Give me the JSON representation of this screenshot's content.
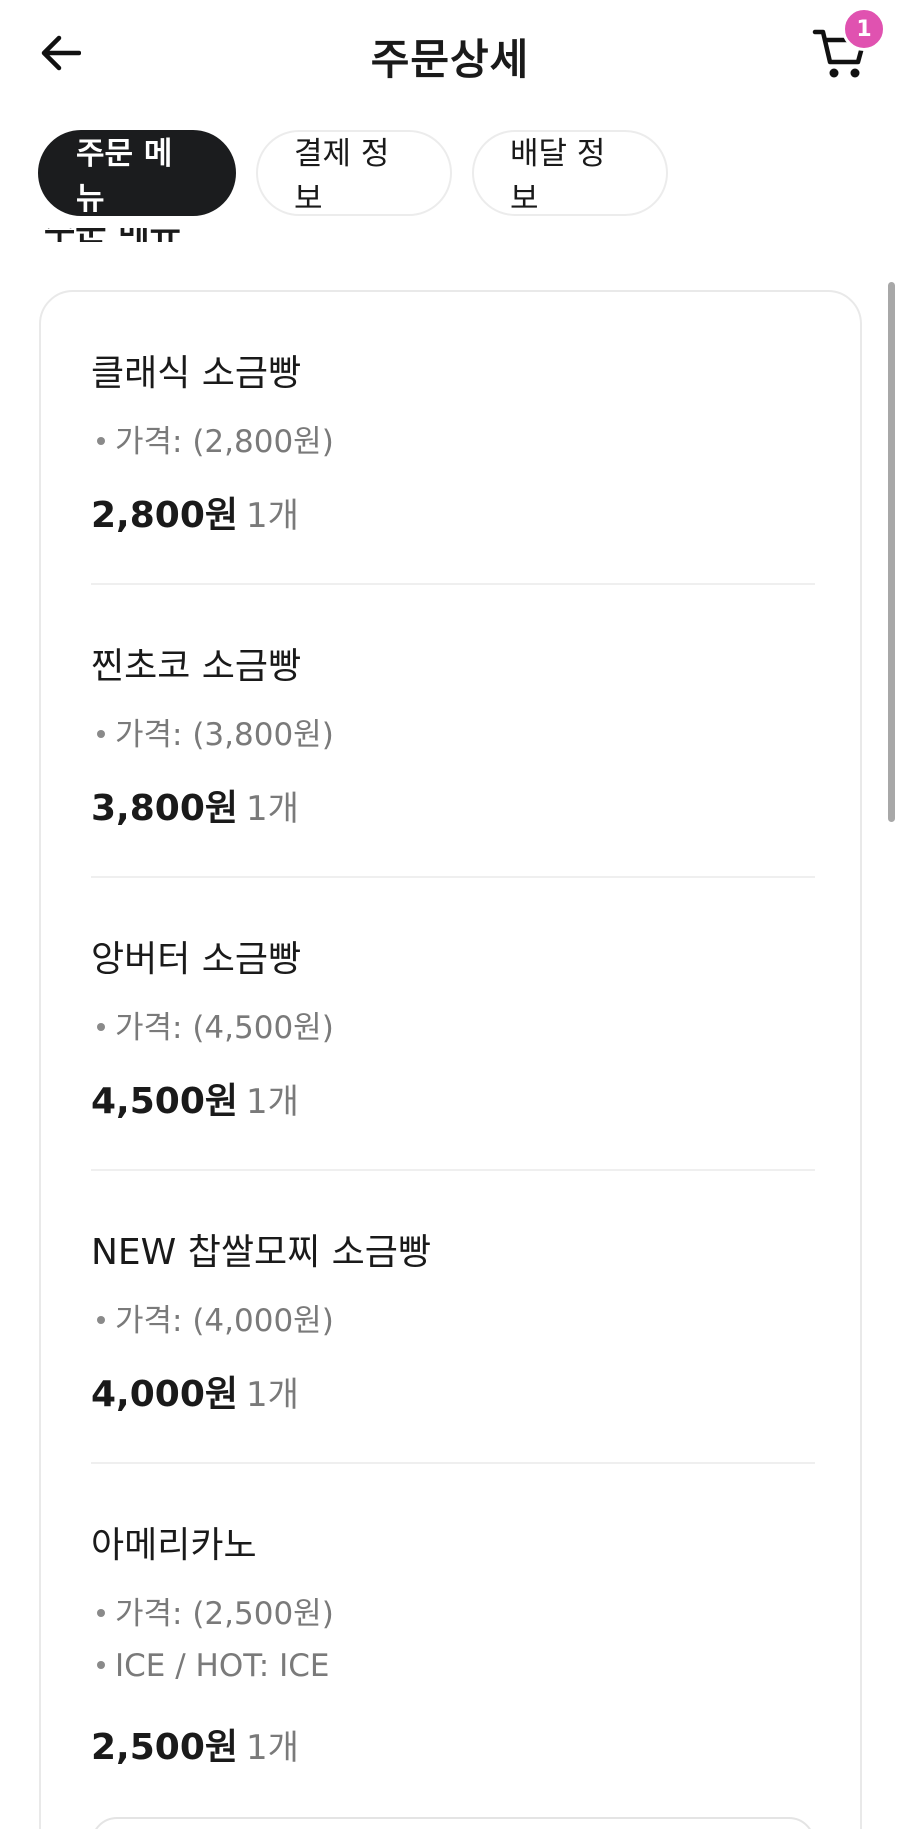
{
  "header": {
    "title": "주문상세",
    "cart_count": "1"
  },
  "tabs": [
    {
      "label": "주문 메뉴",
      "active": true
    },
    {
      "label": "결제 정보",
      "active": false
    },
    {
      "label": "배달 정보",
      "active": false
    }
  ],
  "section": {
    "heading": "주문 메뉴"
  },
  "items": [
    {
      "name": "클래식 소금빵",
      "options": [
        "가격: (2,800원)"
      ],
      "price": "2,800원",
      "qty": "1개"
    },
    {
      "name": "찐초코 소금빵",
      "options": [
        "가격: (3,800원)"
      ],
      "price": "3,800원",
      "qty": "1개"
    },
    {
      "name": "앙버터 소금빵",
      "options": [
        "가격: (4,500원)"
      ],
      "price": "4,500원",
      "qty": "1개"
    },
    {
      "name": "NEW 찹쌀모찌 소금빵",
      "options": [
        "가격: (4,000원)"
      ],
      "price": "4,000원",
      "qty": "1개"
    },
    {
      "name": "아메리카노",
      "options": [
        "가격: (2,500원)",
        "ICE / HOT: ICE"
      ],
      "price": "2,500원",
      "qty": "1개"
    }
  ],
  "colors": {
    "accent_badge": "#e052b0",
    "active_tab": "#1b1c1e",
    "muted_text": "#7a7a7a"
  },
  "icons": {
    "back": "arrow-left-icon",
    "cart": "cart-icon"
  }
}
